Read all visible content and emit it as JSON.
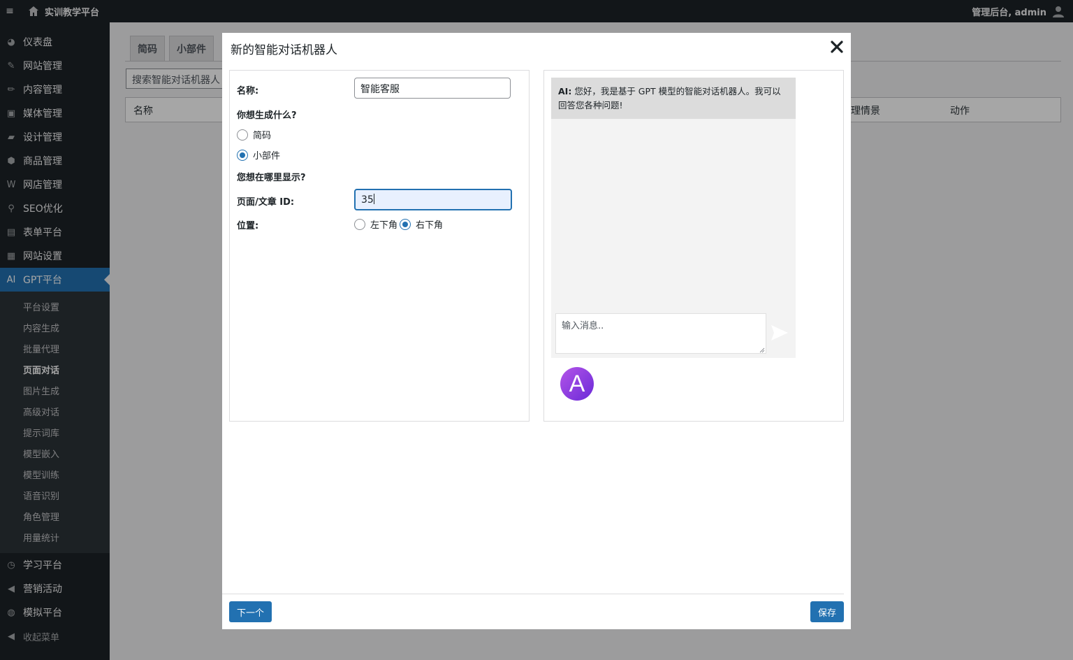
{
  "topbar": {
    "menu_glyph": "≡",
    "site_name": "实训教学平台",
    "user_greeting": "管理后台, admin"
  },
  "sidebar": {
    "items": [
      {
        "label": "仪表盘",
        "icon": "dashboard-icon",
        "glyph": "◕"
      },
      {
        "label": "网站管理",
        "icon": "pin-icon",
        "glyph": "✎"
      },
      {
        "label": "内容管理",
        "icon": "pencil-icon",
        "glyph": "✏"
      },
      {
        "label": "媒体管理",
        "icon": "media-icon",
        "glyph": "▣"
      },
      {
        "label": "设计管理",
        "icon": "folder-icon",
        "glyph": "▰"
      },
      {
        "label": "商品管理",
        "icon": "box-icon",
        "glyph": "⬢"
      },
      {
        "label": "网店管理",
        "icon": "woo-icon",
        "glyph": "W"
      },
      {
        "label": "SEO优化",
        "icon": "search-icon",
        "glyph": "⚲"
      },
      {
        "label": "表单平台",
        "icon": "form-icon",
        "glyph": "▤"
      },
      {
        "label": "网站设置",
        "icon": "settings-icon",
        "glyph": "▦"
      },
      {
        "label": "GPT平台",
        "icon": "ai-icon",
        "glyph": "AI"
      }
    ],
    "submenu": [
      "平台设置",
      "内容生成",
      "批量代理",
      "页面对话",
      "图片生成",
      "高级对话",
      "提示词库",
      "模型嵌入",
      "模型训练",
      "语音识别",
      "角色管理",
      "用量统计"
    ],
    "items_after": [
      {
        "label": "学习平台",
        "icon": "learn-icon",
        "glyph": "◷"
      },
      {
        "label": "营销活动",
        "icon": "megaphone-icon",
        "glyph": "◀"
      },
      {
        "label": "模拟平台",
        "icon": "globe-icon",
        "glyph": "◍"
      }
    ],
    "collapse_label": "收起菜单"
  },
  "page": {
    "tabs": [
      "简码",
      "小部件"
    ],
    "search_placeholder": "搜索智能对话机器人",
    "columns": [
      "名称",
      "理情景",
      "动作"
    ]
  },
  "modal": {
    "title": "新的智能对话机器人",
    "name_label": "名称:",
    "name_value": "智能客服",
    "generate_question": "你想生成什么?",
    "generate_options": [
      "简码",
      "小部件"
    ],
    "generate_selected": "小部件",
    "display_question": "您想在哪里显示?",
    "page_id_label": "页面/文章 ID:",
    "page_id_value": "35",
    "position_label": "位置:",
    "position_options": [
      "左下角",
      "右下角"
    ],
    "position_selected": "右下角",
    "preview": {
      "ai_prefix": "AI:",
      "ai_message": "您好，我是基于 GPT 模型的智能对话机器人。我可以回答您各种问题!",
      "input_placeholder": "输入消息..",
      "avatar_letter": "A"
    },
    "next_button": "下一个",
    "save_button": "保存"
  },
  "colors": {
    "accent": "#2271b1",
    "sidebar_bg": "#1d2327"
  }
}
